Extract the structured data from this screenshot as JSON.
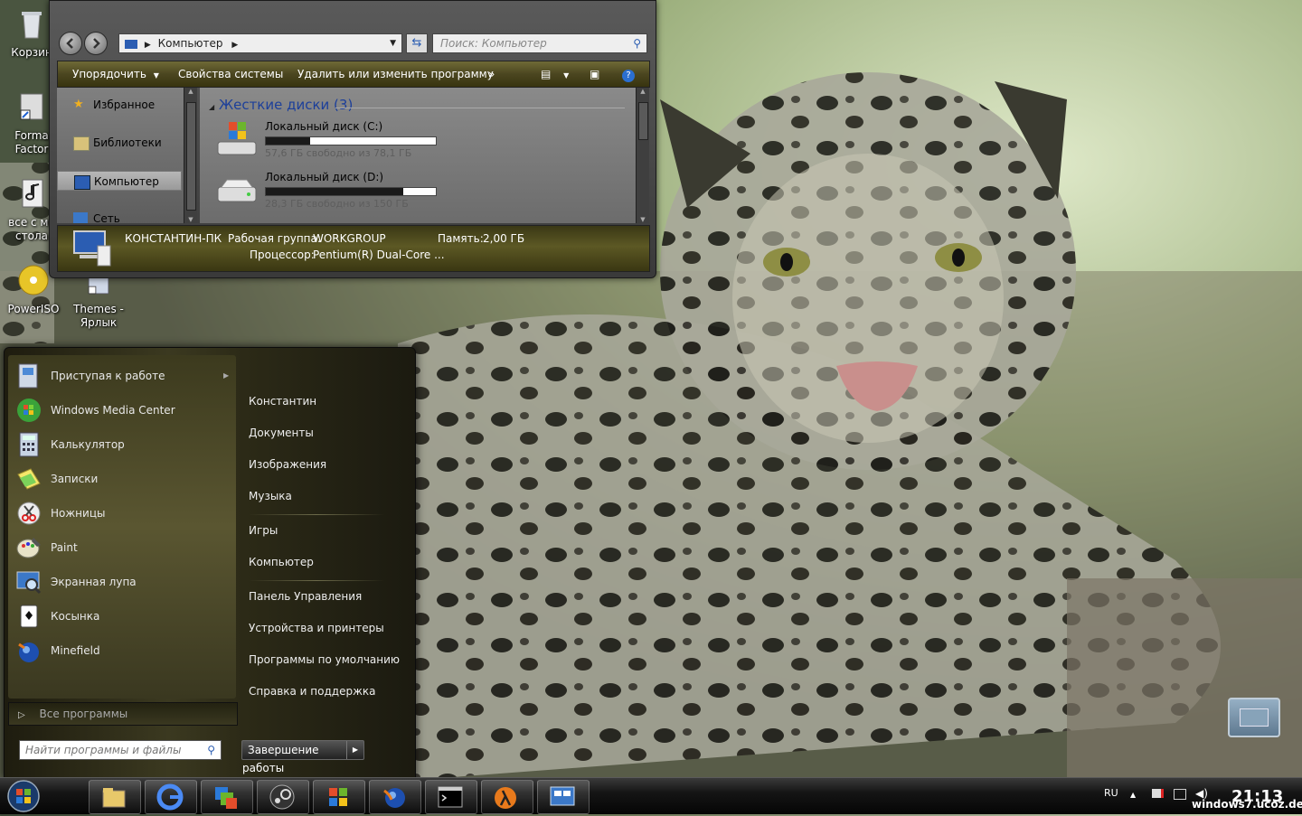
{
  "desktop_icons": [
    {
      "label": "Корзин",
      "icon": "recycle-bin-icon"
    },
    {
      "label": "Forma\nFactor",
      "icon": "shortcut-icon"
    },
    {
      "label": "все с мо\nстола",
      "icon": "music-file-icon"
    },
    {
      "label": "PowerISO",
      "icon": "disc-icon"
    },
    {
      "label": "Themes -\nЯрлык",
      "icon": "themes-shortcut-icon"
    }
  ],
  "explorer": {
    "address": "Компьютер",
    "search_placeholder": "Поиск: Компьютер",
    "toolbar": {
      "organize": "Упорядочить",
      "system_properties": "Свойства системы",
      "uninstall": "Удалить или изменить программу",
      "more": "»"
    },
    "nav": [
      {
        "label": "Избранное",
        "icon": "star-icon"
      },
      {
        "label": "Библиотеки",
        "icon": "library-icon"
      },
      {
        "label": "Компьютер",
        "icon": "computer-icon"
      },
      {
        "label": "Сеть",
        "icon": "network-icon"
      }
    ],
    "group_header": "Жесткие диски (3)",
    "drives": [
      {
        "name": "Локальный диск (C:)",
        "free": "57,6 ГБ свободно из 78,1 ГБ",
        "used_fraction": 0.26
      },
      {
        "name": "Локальный диск (D:)",
        "free": "28,3 ГБ свободно из 150 ГБ",
        "used_fraction": 0.81
      }
    ],
    "details": {
      "computer_name": "КОНСТАНТИН-ПК",
      "workgroup_label": "Рабочая группа:",
      "workgroup": "WORKGROUP",
      "memory_label": "Память:",
      "memory": "2,00 ГБ",
      "cpu_label": "Процессор:",
      "cpu": "Pentium(R) Dual-Core ..."
    }
  },
  "start_menu": {
    "programs": [
      {
        "label": "Приступая к работе",
        "icon": "getting-started-icon",
        "has_arrow": true
      },
      {
        "label": "Windows Media Center",
        "icon": "media-center-icon"
      },
      {
        "label": "Калькулятор",
        "icon": "calculator-icon"
      },
      {
        "label": "Записки",
        "icon": "sticky-notes-icon"
      },
      {
        "label": "Ножницы",
        "icon": "scissors-icon"
      },
      {
        "label": "Paint",
        "icon": "paint-icon"
      },
      {
        "label": "Экранная лупа",
        "icon": "magnifier-icon"
      },
      {
        "label": "Косынка",
        "icon": "solitaire-icon"
      },
      {
        "label": "Minefield",
        "icon": "minefield-icon"
      }
    ],
    "all_programs": "Все программы",
    "right": [
      "Константин",
      "Документы",
      "Изображения",
      "Музыка",
      "Игры",
      "Компьютер",
      "Панель  Управления",
      "Устройства и принтеры",
      "Программы по умолчанию",
      "Справка и поддержка"
    ],
    "search_placeholder": "Найти программы и файлы",
    "shutdown": "Завершение работы"
  },
  "taskbar": {
    "pinned": [
      "explorer-icon",
      "google-icon",
      "windows-switch-icon",
      "steam-icon",
      "windows-flag-icon",
      "firefox-icon",
      "cmd-icon",
      "half-life-icon",
      "control-panel-icon"
    ],
    "lang": "RU",
    "clock": "21:13",
    "watermark": "windows7.ucoz.de"
  },
  "colors": {
    "toolbar": "#4b4620",
    "group_header": "#1c3f9a",
    "drive_bar": "#1a1a1a"
  }
}
